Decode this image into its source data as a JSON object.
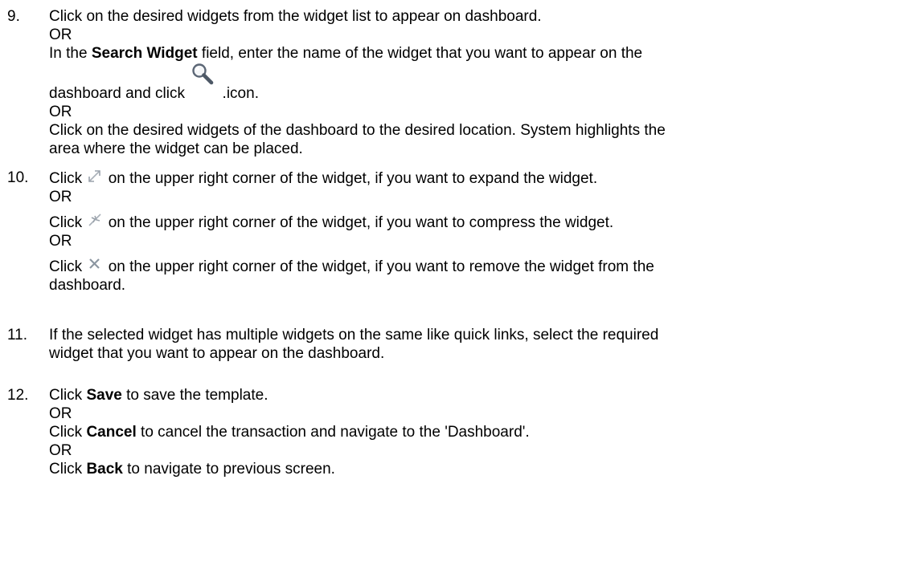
{
  "steps": [
    {
      "number": "9.",
      "line1": "Click on the desired widgets from the widget list to appear on dashboard.",
      "or1": "OR",
      "l2_pre": "In the ",
      "l2_bold": "Search Widget",
      "l2_post": " field, enter the name of the widget that you want to appear on the",
      "l3_pre": "dashboard and click ",
      "l3_post": " .icon.",
      "or2": "OR",
      "line4": "Click on the desired widgets of the dashboard to the desired location. System highlights the",
      "line5": "area where the widget can be placed."
    },
    {
      "number": "10.",
      "l1_pre": "Click ",
      "l1_post": " on the upper right corner of the widget, if you want to expand the widget.",
      "or1": "OR",
      "l2_pre": "Click ",
      "l2_post": " on the upper right corner of the widget, if you want to compress the widget.",
      "or2": "OR",
      "l3_pre": "Click ",
      "l3_post": " on the upper right corner of the widget, if you want to remove the widget from the",
      "l4": "dashboard."
    },
    {
      "number": "11.",
      "line1": "If the selected widget has multiple widgets on the same like quick links, select the required",
      "line2": "widget that you want to appear on the dashboard."
    },
    {
      "number": "12.",
      "l1_pre": "Click ",
      "l1_bold": "Save",
      "l1_post": " to save the template.",
      "or1": "OR",
      "l2_pre": "Click ",
      "l2_bold": "Cancel",
      "l2_post": " to cancel the transaction and navigate to the 'Dashboard'.",
      "or2": "OR",
      "l3_pre": "Click ",
      "l3_bold": "Back",
      "l3_post": " to navigate to previous screen."
    }
  ],
  "icons": {
    "search": "search-icon",
    "expand": "expand-icon",
    "compress": "compress-icon",
    "close": "close-icon"
  }
}
